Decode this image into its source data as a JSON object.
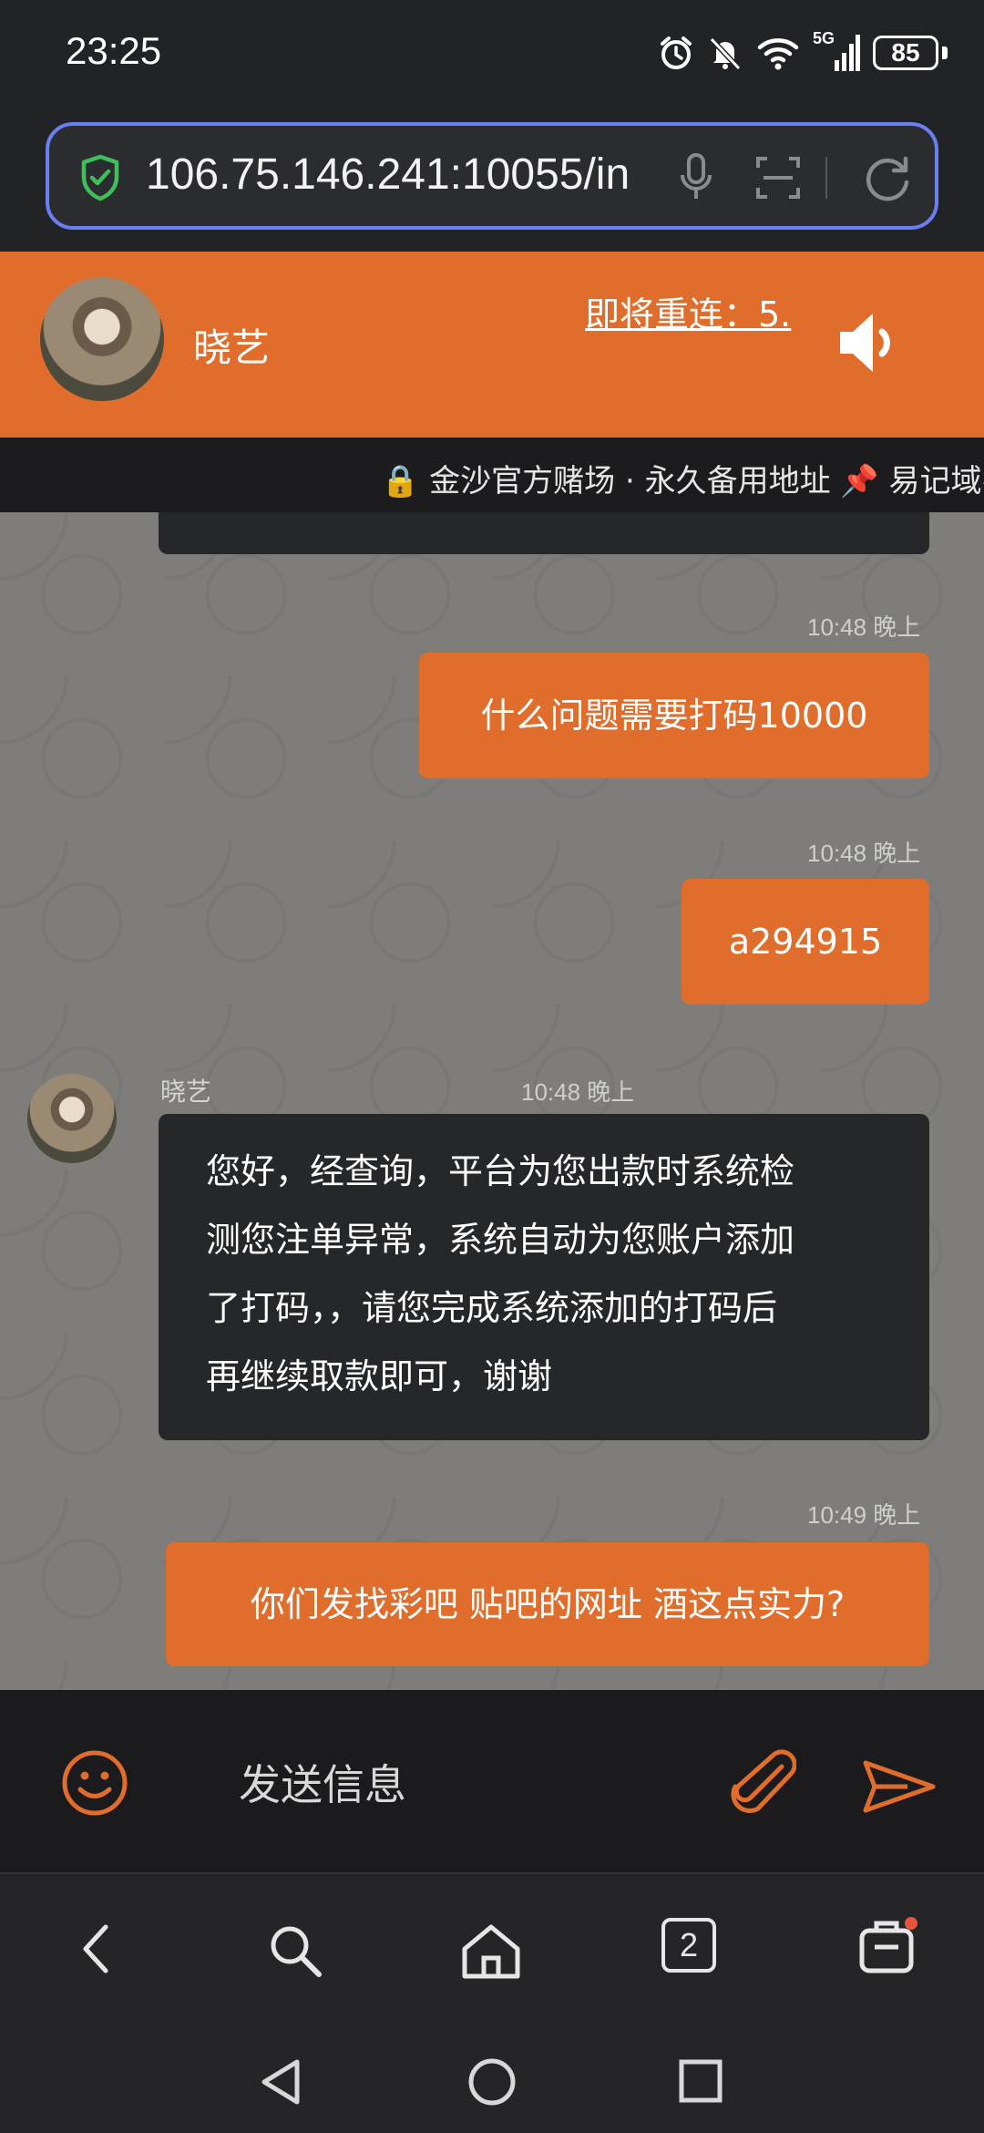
{
  "status_bar": {
    "time": "23:25",
    "network": "5G",
    "battery": "85",
    "icons": [
      "alarm-icon",
      "mute-icon",
      "wifi-icon",
      "signal-icon",
      "battery-icon"
    ]
  },
  "browser": {
    "url": "106.75.146.241:10055/in",
    "icons": [
      "shield-check-icon",
      "microphone-icon",
      "scan-icon",
      "reload-icon"
    ]
  },
  "chat_header": {
    "agent_name": "晓艺",
    "reconnect_text": "即将重连：5.",
    "speaker_icon": "speaker-icon"
  },
  "marquee": {
    "text": "🔒 金沙官方赌场 · 永久备用地址 📌 易记域名"
  },
  "messages": [
    {
      "direction": "out",
      "time": "10:48 晚上",
      "text": "什么问题需要打码10000"
    },
    {
      "direction": "out",
      "time": "10:48 晚上",
      "text": "a294915"
    },
    {
      "direction": "in",
      "sender": "晓艺",
      "time": "10:48 晚上",
      "lines": [
        "您好，经查询，平台为您出款时系统检",
        "测您注单异常，系统自动为您账户添加",
        "了打码，，请您完成系统添加的打码后",
        "再继续取款即可，谢谢"
      ]
    },
    {
      "direction": "out",
      "time": "10:49 晚上",
      "text": "你们发找彩吧 贴吧的网址 酒这点实力?"
    }
  ],
  "input_bar": {
    "placeholder": "发送信息",
    "icons": [
      "emoji-icon",
      "paperclip-icon",
      "send-icon"
    ]
  },
  "browser_nav": {
    "tab_count": "2",
    "icons": [
      "back-icon",
      "search-icon",
      "home-icon",
      "tabs-icon",
      "toolbox-icon"
    ],
    "accent_dot": "#e8553f"
  },
  "colors": {
    "accent": "#e06d2b",
    "url_border": "#6c7ff0",
    "incoming_bubble": "#262729",
    "chat_background": "#7f7d7a"
  }
}
